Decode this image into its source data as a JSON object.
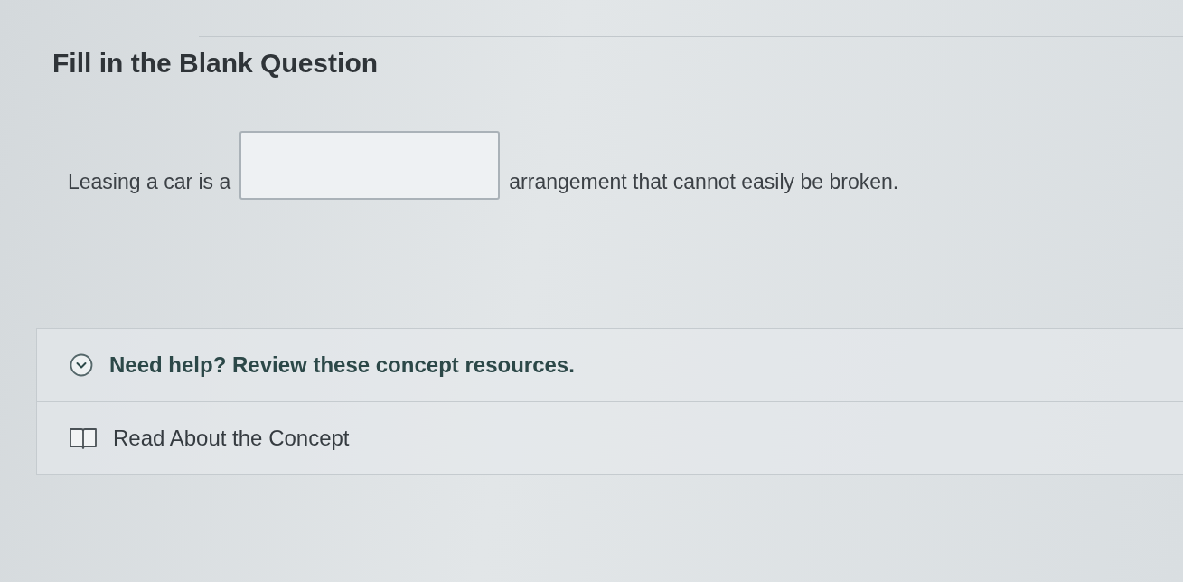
{
  "title": "Fill in the Blank Question",
  "question": {
    "parts": [
      {
        "kind": "text",
        "text": "Leasing a car is a"
      },
      {
        "kind": "blank"
      },
      {
        "kind": "text",
        "text": "arrangement that cannot easily be broken."
      }
    ]
  },
  "help": {
    "heading": "Need help? Review these concept resources.",
    "expanded": true
  },
  "resources": [
    {
      "label": "Read About the Concept"
    }
  ]
}
